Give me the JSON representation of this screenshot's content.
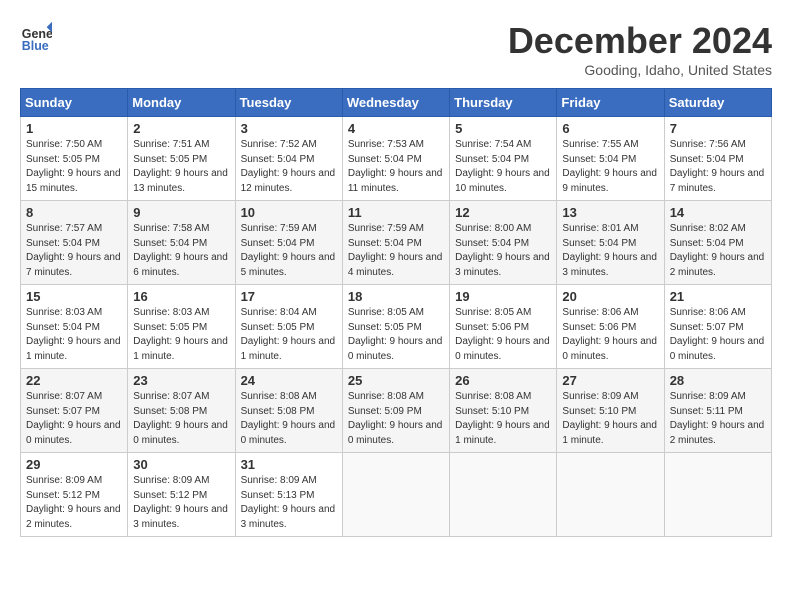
{
  "header": {
    "logo_line1": "General",
    "logo_line2": "Blue",
    "month": "December 2024",
    "location": "Gooding, Idaho, United States"
  },
  "days_of_week": [
    "Sunday",
    "Monday",
    "Tuesday",
    "Wednesday",
    "Thursday",
    "Friday",
    "Saturday"
  ],
  "weeks": [
    [
      {
        "day": "1",
        "sunrise": "7:50 AM",
        "sunset": "5:05 PM",
        "daylight": "9 hours and 15 minutes."
      },
      {
        "day": "2",
        "sunrise": "7:51 AM",
        "sunset": "5:05 PM",
        "daylight": "9 hours and 13 minutes."
      },
      {
        "day": "3",
        "sunrise": "7:52 AM",
        "sunset": "5:04 PM",
        "daylight": "9 hours and 12 minutes."
      },
      {
        "day": "4",
        "sunrise": "7:53 AM",
        "sunset": "5:04 PM",
        "daylight": "9 hours and 11 minutes."
      },
      {
        "day": "5",
        "sunrise": "7:54 AM",
        "sunset": "5:04 PM",
        "daylight": "9 hours and 10 minutes."
      },
      {
        "day": "6",
        "sunrise": "7:55 AM",
        "sunset": "5:04 PM",
        "daylight": "9 hours and 9 minutes."
      },
      {
        "day": "7",
        "sunrise": "7:56 AM",
        "sunset": "5:04 PM",
        "daylight": "9 hours and 7 minutes."
      }
    ],
    [
      {
        "day": "8",
        "sunrise": "7:57 AM",
        "sunset": "5:04 PM",
        "daylight": "9 hours and 7 minutes."
      },
      {
        "day": "9",
        "sunrise": "7:58 AM",
        "sunset": "5:04 PM",
        "daylight": "9 hours and 6 minutes."
      },
      {
        "day": "10",
        "sunrise": "7:59 AM",
        "sunset": "5:04 PM",
        "daylight": "9 hours and 5 minutes."
      },
      {
        "day": "11",
        "sunrise": "7:59 AM",
        "sunset": "5:04 PM",
        "daylight": "9 hours and 4 minutes."
      },
      {
        "day": "12",
        "sunrise": "8:00 AM",
        "sunset": "5:04 PM",
        "daylight": "9 hours and 3 minutes."
      },
      {
        "day": "13",
        "sunrise": "8:01 AM",
        "sunset": "5:04 PM",
        "daylight": "9 hours and 3 minutes."
      },
      {
        "day": "14",
        "sunrise": "8:02 AM",
        "sunset": "5:04 PM",
        "daylight": "9 hours and 2 minutes."
      }
    ],
    [
      {
        "day": "15",
        "sunrise": "8:03 AM",
        "sunset": "5:04 PM",
        "daylight": "9 hours and 1 minute."
      },
      {
        "day": "16",
        "sunrise": "8:03 AM",
        "sunset": "5:05 PM",
        "daylight": "9 hours and 1 minute."
      },
      {
        "day": "17",
        "sunrise": "8:04 AM",
        "sunset": "5:05 PM",
        "daylight": "9 hours and 1 minute."
      },
      {
        "day": "18",
        "sunrise": "8:05 AM",
        "sunset": "5:05 PM",
        "daylight": "9 hours and 0 minutes."
      },
      {
        "day": "19",
        "sunrise": "8:05 AM",
        "sunset": "5:06 PM",
        "daylight": "9 hours and 0 minutes."
      },
      {
        "day": "20",
        "sunrise": "8:06 AM",
        "sunset": "5:06 PM",
        "daylight": "9 hours and 0 minutes."
      },
      {
        "day": "21",
        "sunrise": "8:06 AM",
        "sunset": "5:07 PM",
        "daylight": "9 hours and 0 minutes."
      }
    ],
    [
      {
        "day": "22",
        "sunrise": "8:07 AM",
        "sunset": "5:07 PM",
        "daylight": "9 hours and 0 minutes."
      },
      {
        "day": "23",
        "sunrise": "8:07 AM",
        "sunset": "5:08 PM",
        "daylight": "9 hours and 0 minutes."
      },
      {
        "day": "24",
        "sunrise": "8:08 AM",
        "sunset": "5:08 PM",
        "daylight": "9 hours and 0 minutes."
      },
      {
        "day": "25",
        "sunrise": "8:08 AM",
        "sunset": "5:09 PM",
        "daylight": "9 hours and 0 minutes."
      },
      {
        "day": "26",
        "sunrise": "8:08 AM",
        "sunset": "5:10 PM",
        "daylight": "9 hours and 1 minute."
      },
      {
        "day": "27",
        "sunrise": "8:09 AM",
        "sunset": "5:10 PM",
        "daylight": "9 hours and 1 minute."
      },
      {
        "day": "28",
        "sunrise": "8:09 AM",
        "sunset": "5:11 PM",
        "daylight": "9 hours and 2 minutes."
      }
    ],
    [
      {
        "day": "29",
        "sunrise": "8:09 AM",
        "sunset": "5:12 PM",
        "daylight": "9 hours and 2 minutes."
      },
      {
        "day": "30",
        "sunrise": "8:09 AM",
        "sunset": "5:12 PM",
        "daylight": "9 hours and 3 minutes."
      },
      {
        "day": "31",
        "sunrise": "8:09 AM",
        "sunset": "5:13 PM",
        "daylight": "9 hours and 3 minutes."
      },
      null,
      null,
      null,
      null
    ]
  ]
}
